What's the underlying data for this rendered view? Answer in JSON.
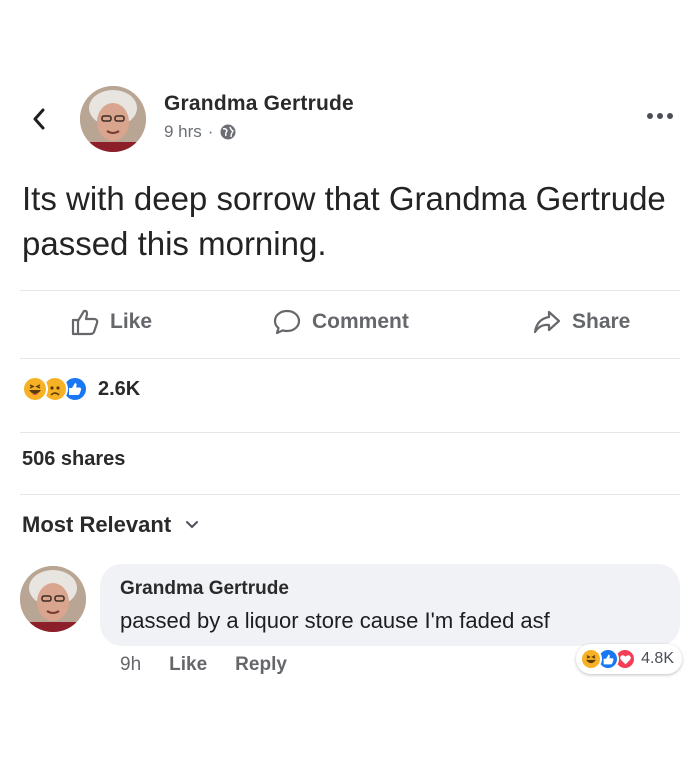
{
  "post": {
    "author": "Grandma Gertrude",
    "time": "9 hrs",
    "separator": "·",
    "privacy_icon": "globe-icon",
    "text": "Its with deep sorrow that Grandma Gertrude passed this morning."
  },
  "actions": {
    "like_label": "Like",
    "comment_label": "Comment",
    "share_label": "Share"
  },
  "reactions": {
    "icons": [
      "haha-icon",
      "sad-icon",
      "like-icon"
    ],
    "count": "2.6K"
  },
  "shares": "506 shares",
  "sort": {
    "label": "Most Relevant"
  },
  "comment": {
    "author": "Grandma Gertrude",
    "text": "passed by a liquor store cause I'm faded asf",
    "time": "9h",
    "like_label": "Like",
    "reply_label": "Reply",
    "reaction_icons": [
      "haha-icon",
      "like-icon",
      "love-icon"
    ],
    "reaction_count": "4.8K"
  },
  "colors": {
    "facebook_blue": "#1877f2",
    "reaction_yellow": "#f7b125",
    "love_red": "#f33e58",
    "muted_text": "#65676b"
  }
}
